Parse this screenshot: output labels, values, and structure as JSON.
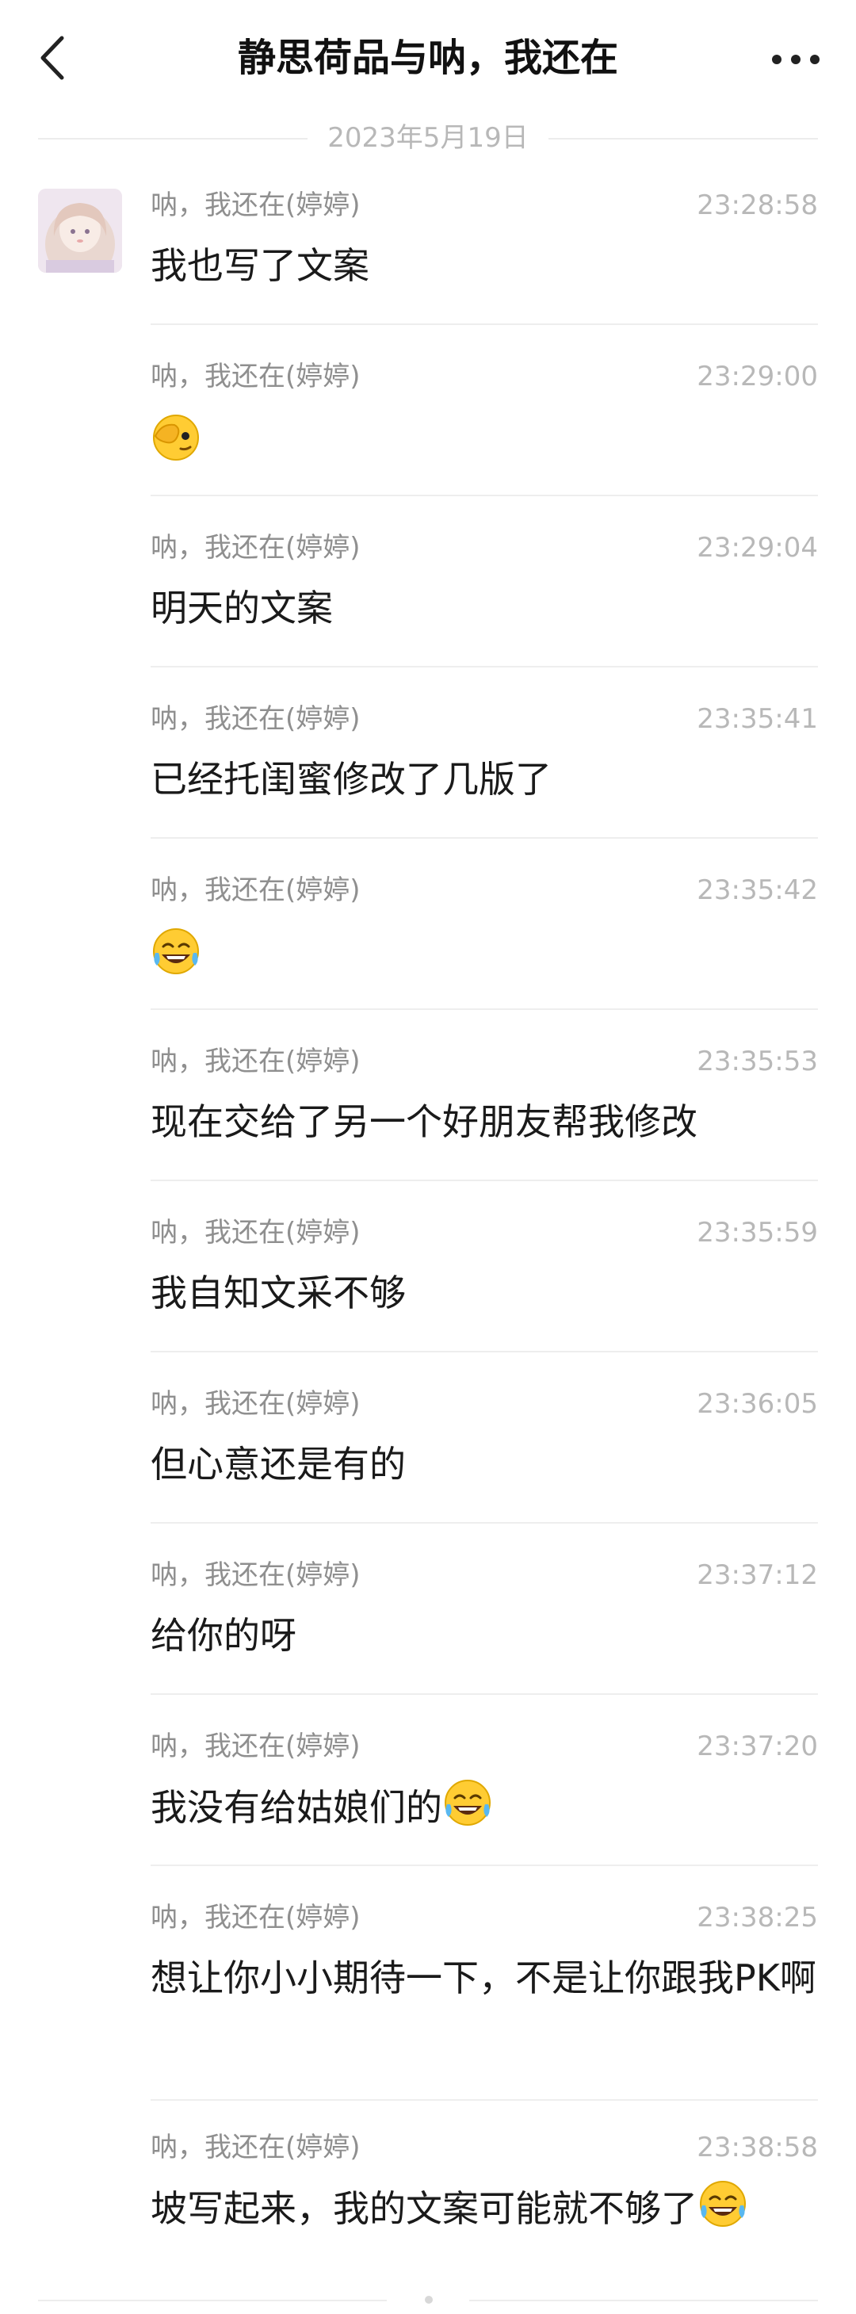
{
  "header": {
    "title": "静思荷品与呐，我还在",
    "back_icon": "chevron-left-icon",
    "more_icon": "more-dots-icon"
  },
  "date_divider": "2023年5月19日",
  "messages": [
    {
      "sender": "呐，我还在(婷婷)",
      "time": "23:28:58",
      "text": "我也写了文案"
    },
    {
      "sender": "呐，我还在(婷婷)",
      "time": "23:29:00",
      "text": "",
      "emoji": "facepalm-peek-emoji"
    },
    {
      "sender": "呐，我还在(婷婷)",
      "time": "23:29:04",
      "text": "明天的文案"
    },
    {
      "sender": "呐，我还在(婷婷)",
      "time": "23:35:41",
      "text": "已经托闺蜜修改了几版了"
    },
    {
      "sender": "呐，我还在(婷婷)",
      "time": "23:35:42",
      "text": "",
      "emoji": "tears-of-joy-emoji"
    },
    {
      "sender": "呐，我还在(婷婷)",
      "time": "23:35:53",
      "text": "现在交给了另一个好朋友帮我修改"
    },
    {
      "sender": "呐，我还在(婷婷)",
      "time": "23:35:59",
      "text": "我自知文采不够"
    },
    {
      "sender": "呐，我还在(婷婷)",
      "time": "23:36:05",
      "text": "但心意还是有的"
    },
    {
      "sender": "呐，我还在(婷婷)",
      "time": "23:37:12",
      "text": "给你的呀"
    },
    {
      "sender": "呐，我还在(婷婷)",
      "time": "23:37:20",
      "text": "我没有给姑娘们的",
      "emoji": "tears-of-joy-emoji"
    },
    {
      "sender": "呐，我还在(婷婷)",
      "time": "23:38:25",
      "text": "想让你小小期待一下，不是让你跟我PK啊"
    },
    {
      "sender": "呐，我还在(婷婷)",
      "time": "23:38:58",
      "text": "坡写起来，我的文案可能就不够了",
      "emoji": "tears-of-joy-emoji"
    }
  ],
  "colors": {
    "title": "#111111",
    "sender": "#8f8f8f",
    "time": "#b8b8b8",
    "text": "#1a1a1a",
    "divider": "#eeeeee"
  }
}
